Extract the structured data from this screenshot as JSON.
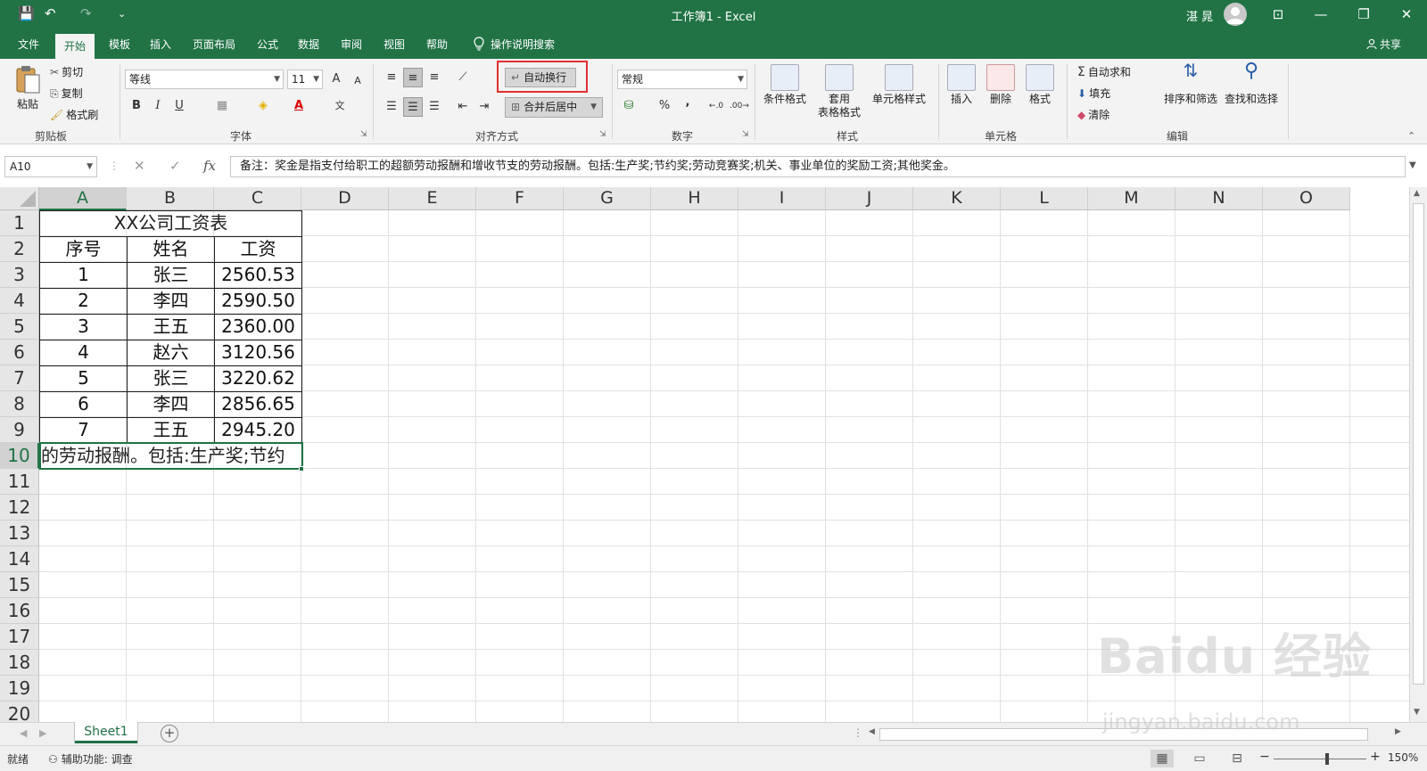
{
  "window": {
    "title": "工作簿1  -  Excel",
    "user_name": "湛 晁",
    "minimize": "—",
    "restore": "❐",
    "close": "✕",
    "ribbon_display": "⊡"
  },
  "quick_access": {
    "save": "💾",
    "undo": "↶",
    "redo": "↷",
    "customize": "⌄"
  },
  "tabs": [
    {
      "label": "文件"
    },
    {
      "label": "开始"
    },
    {
      "label": "模板"
    },
    {
      "label": "插入"
    },
    {
      "label": "页面布局"
    },
    {
      "label": "公式"
    },
    {
      "label": "数据"
    },
    {
      "label": "审阅"
    },
    {
      "label": "视图"
    },
    {
      "label": "帮助"
    }
  ],
  "tell_me": "操作说明搜索",
  "share": "共享",
  "ribbon": {
    "clipboard": {
      "label": "剪贴板",
      "paste": "粘贴",
      "cut": "剪切",
      "copy": "复制",
      "format_painter": "格式刷"
    },
    "font": {
      "label": "字体",
      "font_name": "等线",
      "font_size": "11",
      "bold": "B",
      "italic": "I",
      "underline": "U",
      "grow": "A",
      "shrink": "A"
    },
    "alignment": {
      "label": "对齐方式",
      "wrap_text": "自动换行",
      "merge_center": "合并后居中"
    },
    "number": {
      "label": "数字",
      "format": "常规",
      "percent": "%",
      "comma": ","
    },
    "styles": {
      "label": "样式",
      "conditional": "条件格式",
      "table_line1": "套用",
      "table_line2": "表格格式",
      "cell_styles": "单元格样式"
    },
    "cells": {
      "label": "单元格",
      "insert": "插入",
      "delete": "删除",
      "format": "格式"
    },
    "editing": {
      "label": "编辑",
      "autosum": "自动求和",
      "fill": "填充",
      "clear": "清除",
      "sort_filter": "排序和筛选",
      "find_select": "查找和选择"
    }
  },
  "formula_bar": {
    "name_box": "A10",
    "fx": "fx",
    "content": "备注：奖金是指支付给职工的超额劳动报酬和增收节支的劳动报酬。包括:生产奖;节约奖;劳动竞赛奖;机关、事业单位的奖励工资;其他奖金。"
  },
  "columns": [
    "A",
    "B",
    "C",
    "D",
    "E",
    "F",
    "G",
    "H",
    "I",
    "J",
    "K",
    "L",
    "M",
    "N",
    "O"
  ],
  "rows": [
    "1",
    "2",
    "3",
    "4",
    "5",
    "6",
    "7",
    "8",
    "9",
    "10",
    "11",
    "12",
    "13",
    "14",
    "15",
    "16",
    "17",
    "18",
    "19",
    "20"
  ],
  "sheet": {
    "title": "XX公司工资表",
    "headers": [
      "序号",
      "姓名",
      "工资"
    ],
    "data": [
      [
        "1",
        "张三",
        "2560.53"
      ],
      [
        "2",
        "李四",
        "2590.50"
      ],
      [
        "3",
        "王五",
        "2360.00"
      ],
      [
        "4",
        "赵六",
        "3120.56"
      ],
      [
        "5",
        "张三",
        "3220.62"
      ],
      [
        "6",
        "李四",
        "2856.65"
      ],
      [
        "7",
        "王五",
        "2945.20"
      ]
    ],
    "a10_visible": "的劳动报酬。包括:生产奖;节约"
  },
  "sheet_tab": "Sheet1",
  "add_sheet": "+",
  "status": {
    "ready": "就绪",
    "accessibility": "辅助功能: 调查",
    "zoom": "150%",
    "zoom_minus": "−",
    "zoom_plus": "+"
  },
  "watermark": {
    "text": "Baidu 经验",
    "sub": "jingyan.baidu.com"
  }
}
